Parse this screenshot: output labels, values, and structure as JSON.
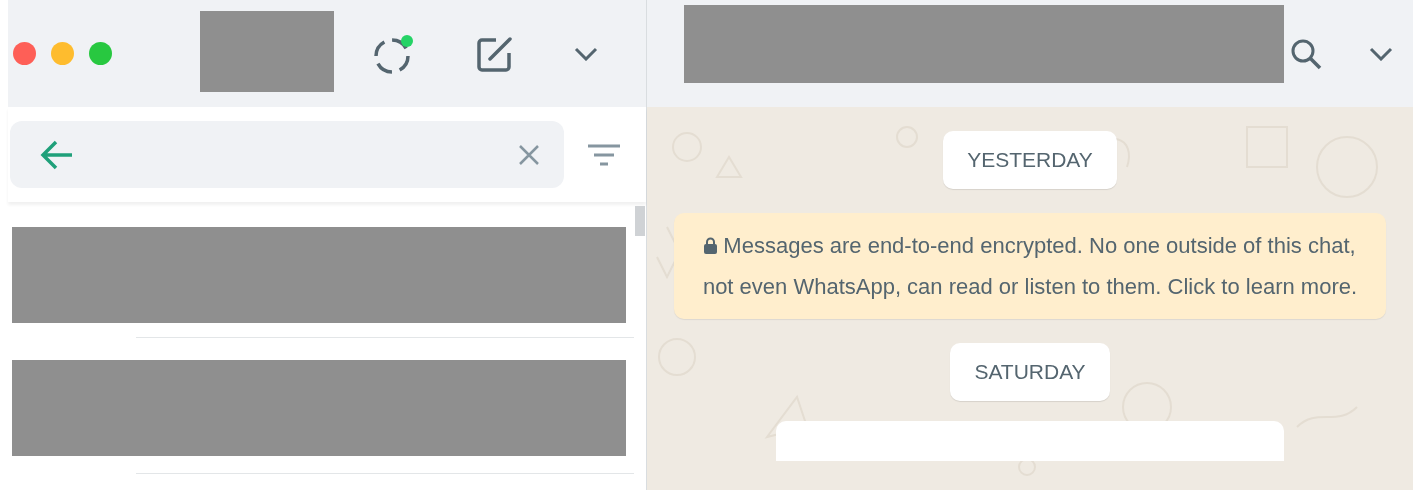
{
  "sidebar": {
    "status_unread": true,
    "chat_rows": [
      {
        "kind": "redacted"
      },
      {
        "kind": "redacted"
      }
    ]
  },
  "chat": {
    "items": [
      {
        "kind": "date",
        "text": "YESTERDAY"
      },
      {
        "kind": "notice",
        "text": "Messages are end-to-end encrypted. No one outside of this chat, not even WhatsApp, can read or listen to them. Click to learn more."
      },
      {
        "kind": "date",
        "text": "SATURDAY"
      },
      {
        "kind": "bubble"
      }
    ]
  }
}
